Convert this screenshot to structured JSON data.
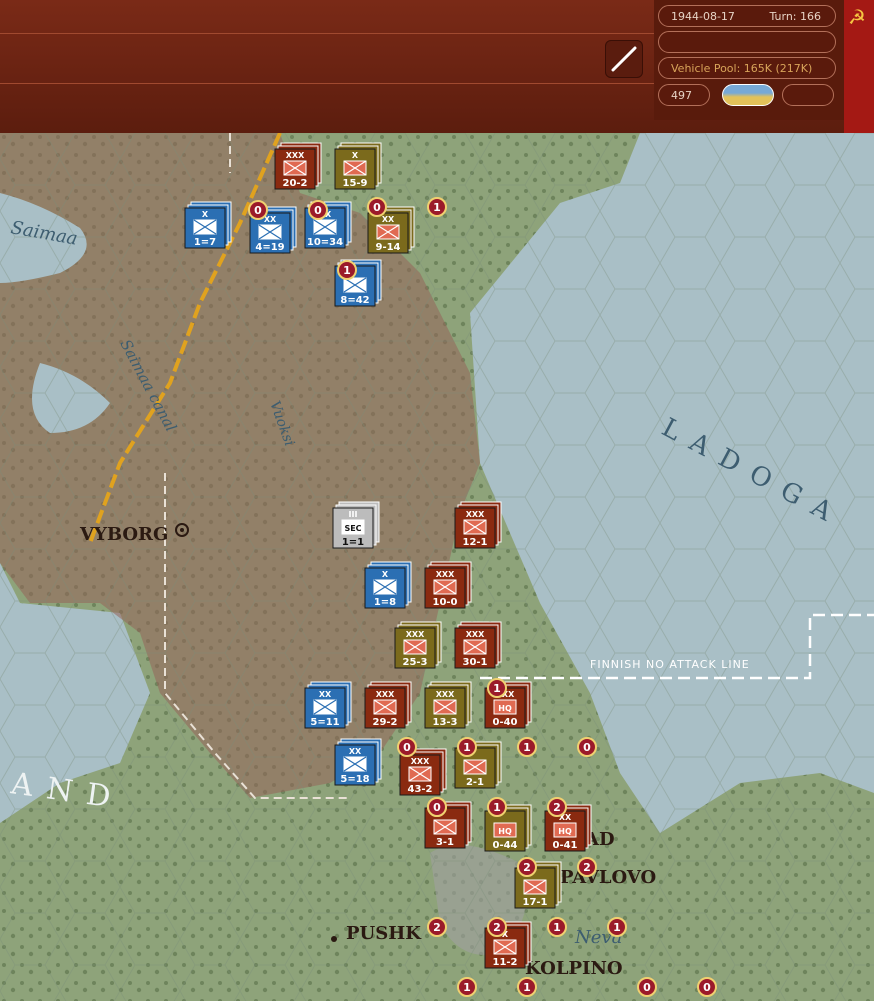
{
  "hud": {
    "date": "1944-08-17",
    "turn": "Turn: 166",
    "vehicle_pool": "Vehicle Pool: 165K (217K)",
    "value": "497",
    "empty_slot_1": "",
    "empty_slot_2": ""
  },
  "map": {
    "places": [
      {
        "name": "VYBORG"
      },
      {
        "name": "PUSHK"
      },
      {
        "name": "PAVLOVO"
      },
      {
        "name": "AD"
      },
      {
        "name": "KOLPINO"
      }
    ],
    "water": {
      "ladoga": "LADOGA",
      "saimaa": "Saimaa",
      "saimaa_canal": "Saimaa canal",
      "vuoksi": "Vuoksi",
      "neva": "Neva",
      "finland_fragment": "AND"
    },
    "finnish_line_label": "FINNISH NO ATTACK LINE",
    "units": [
      {
        "id": "u1",
        "size": "XXX",
        "label": "20-2",
        "side": "soviet"
      },
      {
        "id": "u2",
        "size": "X",
        "label": "15-9",
        "side": "soviet"
      },
      {
        "id": "u3",
        "size": "X",
        "label": "1=7",
        "side": "finnish"
      },
      {
        "id": "u4",
        "size": "XX",
        "label": "4=19",
        "side": "finnish"
      },
      {
        "id": "u5",
        "size": "XX",
        "label": "10=34",
        "side": "finnish"
      },
      {
        "id": "u6",
        "size": "XX",
        "label": "9-14",
        "side": "soviet"
      },
      {
        "id": "u7",
        "size": "",
        "label": "8=42",
        "side": "finnish"
      },
      {
        "id": "u8",
        "size": "III",
        "label": "1=1",
        "side": "neutral",
        "tag": "SEC"
      },
      {
        "id": "u9",
        "size": "XXX",
        "label": "12-1",
        "side": "soviet"
      },
      {
        "id": "u10",
        "size": "X",
        "label": "1=8",
        "side": "finnish"
      },
      {
        "id": "u11",
        "size": "XXX",
        "label": "10-0",
        "side": "soviet"
      },
      {
        "id": "u12",
        "size": "XXX",
        "label": "25-3",
        "side": "soviet"
      },
      {
        "id": "u13",
        "size": "XXX",
        "label": "30-1",
        "side": "soviet"
      },
      {
        "id": "u14",
        "size": "XX",
        "label": "5=11",
        "side": "finnish"
      },
      {
        "id": "u15",
        "size": "XXX",
        "label": "29-2",
        "side": "soviet"
      },
      {
        "id": "u16",
        "size": "XXX",
        "label": "13-3",
        "side": "soviet"
      },
      {
        "id": "u17",
        "size": "XXX",
        "label": "0-40",
        "side": "soviet",
        "tag": "HQ"
      },
      {
        "id": "u18",
        "size": "XX",
        "label": "5=18",
        "side": "finnish"
      },
      {
        "id": "u19",
        "size": "XXX",
        "label": "43-2",
        "side": "soviet"
      },
      {
        "id": "u20",
        "size": "",
        "label": "2-1",
        "side": "soviet"
      },
      {
        "id": "u21",
        "size": "",
        "label": "3-1",
        "side": "soviet"
      },
      {
        "id": "u22",
        "size": "",
        "label": "0-44",
        "side": "soviet",
        "tag": "HQ"
      },
      {
        "id": "u23",
        "size": "XX",
        "label": "0-41",
        "side": "soviet",
        "tag": "HQ"
      },
      {
        "id": "u24",
        "size": "",
        "label": "17-1",
        "side": "soviet"
      },
      {
        "id": "u25",
        "size": "X",
        "label": "11-2",
        "side": "soviet"
      }
    ],
    "badges": [
      "1",
      "0",
      "0",
      "0",
      "1",
      "1",
      "1",
      "0",
      "1",
      "1",
      "0",
      "0",
      "1",
      "2",
      "2",
      "2",
      "2",
      "2",
      "1",
      "1",
      "1",
      "0",
      "0",
      "1"
    ]
  }
}
